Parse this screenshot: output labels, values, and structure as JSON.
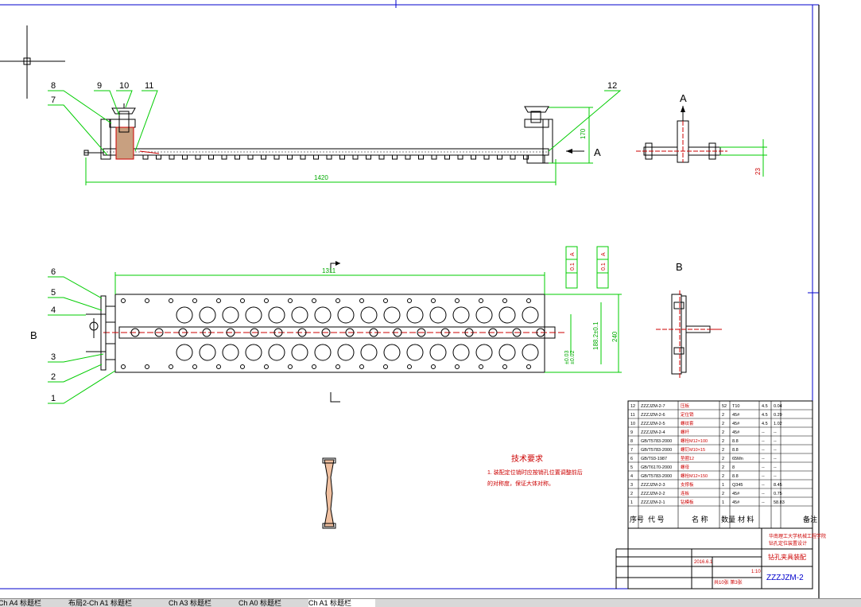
{
  "drawing": {
    "view_label_a": "A",
    "view_label_b": "B",
    "dimensions": {
      "overall_length": "1420",
      "height_170": "170",
      "small_23": "23",
      "width_1311": "1311",
      "height_240": "240",
      "pitch": "188.2±0.1",
      "small_pair": [
        "±0.03",
        "±0.02"
      ],
      "tolerance_label": "0.1",
      "datum": "A"
    },
    "balloons": [
      "1",
      "2",
      "3",
      "4",
      "5",
      "6",
      "7",
      "8",
      "9",
      "10",
      "11",
      "12"
    ],
    "tech_req_title": "技术要求",
    "tech_req_line1": "1. 装配定位销时应按销孔位置调整前后",
    "tech_req_line2": "的对称度，保证大体对称。"
  },
  "title_block": {
    "parts": [
      [
        "12",
        "ZZZJZM-2-7",
        "压板",
        "52",
        "T10",
        "4.5",
        "0.04"
      ],
      [
        "11",
        "ZZZJZM-2-6",
        "定位销",
        "2",
        "45#",
        "4.5",
        "0.29"
      ],
      [
        "10",
        "ZZZJZM-2-5",
        "螺纹套",
        "2",
        "45#",
        "4.5",
        "1.02"
      ],
      [
        "9",
        "ZZZJZM-2-4",
        "螺杆",
        "2",
        "45#",
        "--",
        "--"
      ],
      [
        "8",
        "GB/T5783-2000",
        "螺栓M12×100",
        "2",
        "8.8",
        "--",
        "--"
      ],
      [
        "7",
        "GB/T5783-2000",
        "螺钉M10×15",
        "2",
        "8.8",
        "--",
        "--"
      ],
      [
        "6",
        "GB/T93-1987",
        "垫圈12",
        "2",
        "65Mn",
        "--",
        "--"
      ],
      [
        "5",
        "GB/T6170-2000",
        "螺母",
        "2",
        "8",
        "--",
        "--"
      ],
      [
        "4",
        "GB/T5783-2000",
        "螺栓M12×150",
        "2",
        "8.8",
        "--",
        "--"
      ],
      [
        "3",
        "ZZZJZM-2-3",
        "支撑板",
        "1",
        "Q345",
        "--",
        "8.45"
      ],
      [
        "2",
        "ZZZJZM-2-2",
        "连板",
        "2",
        "45#",
        "--",
        "0.75"
      ],
      [
        "1",
        "ZZZJZM-2-1",
        "钻模板",
        "1",
        "45#",
        "--",
        "58.83"
      ]
    ],
    "header": [
      "序号",
      "代 号",
      "名 称",
      "数量",
      "材 料",
      "",
      "备注"
    ],
    "school": "华南理工大学机械工程学院",
    "title": "钻孔定位装置设计",
    "drawing_name": "钻孔夹具装配",
    "drawing_no": "ZZZJZM-2",
    "date": "2016.6.1",
    "sheet": "共10张 第3张",
    "scale": "1:10"
  },
  "tabs": [
    "Ch A4 标题栏",
    "布局2-Ch A1 标题栏",
    "Ch A3 标题栏",
    "Ch A0 标题栏",
    "Ch A1 标题栏"
  ]
}
